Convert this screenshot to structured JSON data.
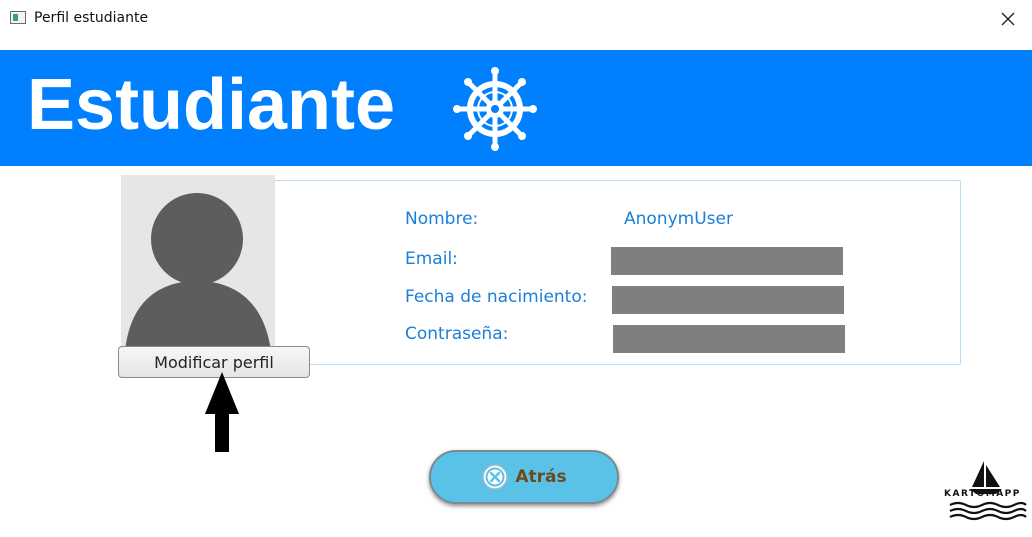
{
  "window": {
    "title": "Perfil estudiante"
  },
  "header": {
    "title": "Estudiante",
    "background_color": "#0080ff",
    "icon": "ship-wheel-icon"
  },
  "profile": {
    "fields": [
      {
        "label": "Nombre:",
        "value": "AnonymUser"
      },
      {
        "label": "Email:",
        "value": "",
        "redacted": true
      },
      {
        "label": "Fecha de nacimiento:",
        "value": "",
        "redacted": true
      },
      {
        "label": "Contraseña:",
        "value": "",
        "redacted": true
      }
    ],
    "avatar_icon": "user-silhouette-icon",
    "label_color": "#1a7fd8"
  },
  "actions": {
    "modify_label": "Modificar perfil",
    "back_label": "Atrás",
    "back_icon": "close-circle-icon",
    "back_color": "#5bc2e7"
  },
  "annotation": {
    "arrow_icon": "arrow-up-icon"
  },
  "branding": {
    "logo_text": "KARTOMAPP",
    "logo_icon": "sailboat-icon"
  }
}
